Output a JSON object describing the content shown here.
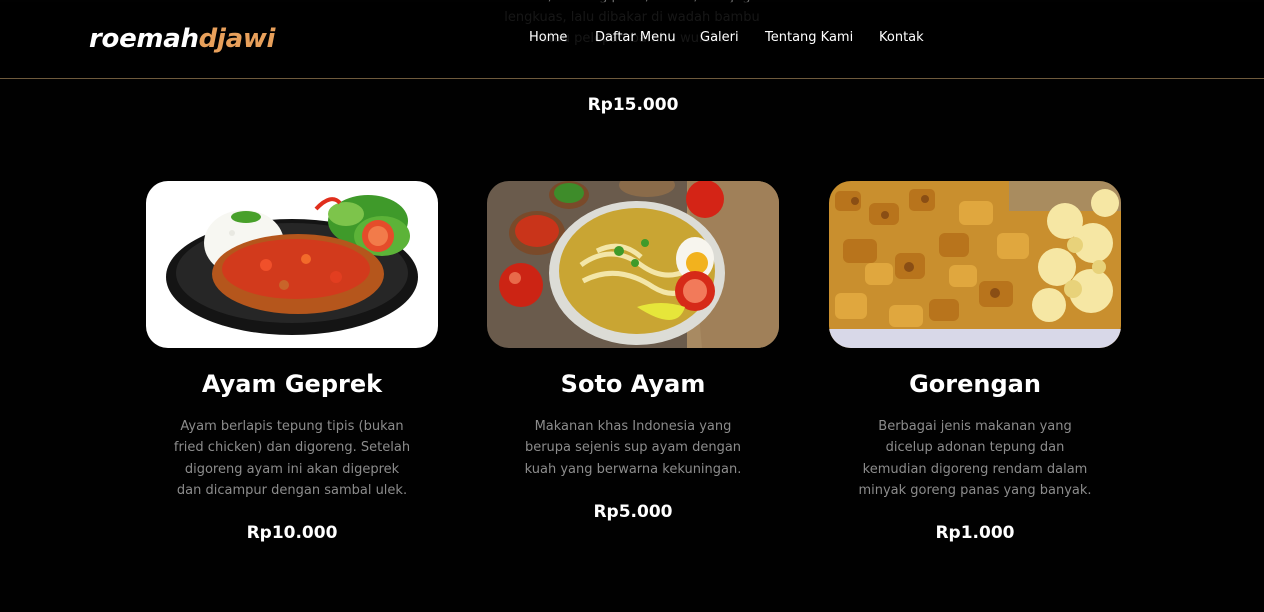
{
  "colors": {
    "background": "#010101",
    "accent": "#e8a05b",
    "nav_border": "#6e5a3c"
  },
  "navbar": {
    "logo_part1": "roemah",
    "logo_part2": "djawi",
    "links": [
      "Home",
      "Daftar Menu",
      "Galeri",
      "Tentang Kami",
      "Kontak"
    ]
  },
  "previous_item": {
    "description": "merah, bawang putih, kemiri, dan juga lengkuas, lalu dibakar di wadah bambu atau pelepah bambu wuluh.",
    "price": "Rp15.000"
  },
  "menu": [
    {
      "image": "ayam-geprek-photo",
      "title": "Ayam Geprek",
      "description": "Ayam berlapis tepung tipis (bukan fried chicken) dan digoreng. Setelah digoreng ayam ini akan digeprek dan dicampur dengan sambal ulek.",
      "price": "Rp10.000"
    },
    {
      "image": "soto-ayam-photo",
      "title": "Soto Ayam",
      "description": "Makanan khas Indonesia yang berupa sejenis sup ayam dengan kuah yang berwarna kekuningan.",
      "price": "Rp5.000"
    },
    {
      "image": "gorengan-photo",
      "title": "Gorengan",
      "description": "Berbagai jenis makanan yang dicelup adonan tepung dan kemudian digoreng rendam dalam minyak goreng panas yang banyak.",
      "price": "Rp1.000"
    }
  ]
}
